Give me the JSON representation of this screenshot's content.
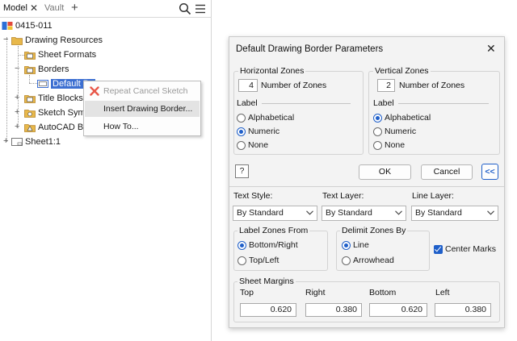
{
  "browser": {
    "tabs": [
      {
        "label": "Model"
      },
      {
        "label": "Vault"
      }
    ],
    "tree": {
      "root": "0415-011",
      "drawing_resources": "Drawing Resources",
      "sheet_formats": "Sheet Formats",
      "borders": "Borders",
      "default_border": "Default Bo",
      "title_blocks": "Title Blocks",
      "sketch_symbols": "Sketch Symbo",
      "autocad_blocks": "AutoCAD Bloc",
      "sheet": "Sheet1:1"
    },
    "context_menu": {
      "repeat": "Repeat Cancel Sketch",
      "insert": "Insert Drawing Border...",
      "howto": "How To..."
    }
  },
  "dialog": {
    "title": "Default Drawing Border Parameters",
    "horizontal": {
      "title": "Horizontal Zones",
      "count": "4",
      "count_label": "Number of Zones",
      "label_heading": "Label",
      "options": [
        "Alphabetical",
        "Numeric",
        "None"
      ],
      "selected": "Numeric"
    },
    "vertical": {
      "title": "Vertical Zones",
      "count": "2",
      "count_label": "Number of Zones",
      "label_heading": "Label",
      "options": [
        "Alphabetical",
        "Numeric",
        "None"
      ],
      "selected": "Alphabetical"
    },
    "buttons": {
      "ok": "OK",
      "cancel": "Cancel",
      "collapse": "<<",
      "help": "?"
    },
    "text_style": {
      "label": "Text Style:",
      "value": "By Standard"
    },
    "text_layer": {
      "label": "Text Layer:",
      "value": "By Standard"
    },
    "line_layer": {
      "label": "Line Layer:",
      "value": "By Standard"
    },
    "label_zones_from": {
      "title": "Label Zones From",
      "options": [
        "Bottom/Right",
        "Top/Left"
      ],
      "selected": "Bottom/Right"
    },
    "delimit_zones_by": {
      "title": "Delimit Zones By",
      "options": [
        "Line",
        "Arrowhead"
      ],
      "selected": "Line"
    },
    "center_marks": {
      "label": "Center Marks",
      "checked": true
    },
    "sheet_margins": {
      "title": "Sheet Margins",
      "top": {
        "label": "Top",
        "value": "0.620"
      },
      "right": {
        "label": "Right",
        "value": "0.380"
      },
      "bottom": {
        "label": "Bottom",
        "value": "0.620"
      },
      "left": {
        "label": "Left",
        "value": "0.380"
      }
    }
  },
  "colors": {
    "accent": "#1f5fc9",
    "selection": "#3c6fd1",
    "folder": "#e8b84a"
  }
}
